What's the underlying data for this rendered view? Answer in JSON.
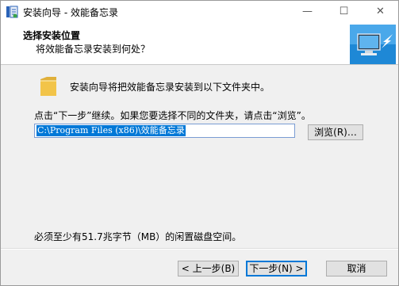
{
  "window": {
    "title": "安装向导 - 效能备忘录",
    "minimize_glyph": "—",
    "maximize_glyph": "☐",
    "close_glyph": "✕"
  },
  "header": {
    "title": "选择安装位置",
    "subtitle": "将效能备忘录安装到何处？"
  },
  "body": {
    "intro": "安装向导将把效能备忘录安装到以下文件夹中。",
    "instruction": "点击“下一步”继续。如果您要选择不同的文件夹，请点击“浏览”。",
    "path_value": "C:\\Program Files (x86)\\效能备忘录",
    "browse_label": "浏览(R)…",
    "space_required": "必须至少有51.7兆字节（MB）的闲置磁盘空间。"
  },
  "buttons": {
    "back": "< 上一步(B)",
    "next": "下一步(N) >",
    "cancel": "取消"
  },
  "icons": {
    "app": "setup-app-icon",
    "header": "computer-install-icon",
    "folder": "folder-icon"
  },
  "colors": {
    "selection": "#0078d7",
    "focus_border": "#0078d7",
    "folder": "#f2c449"
  }
}
